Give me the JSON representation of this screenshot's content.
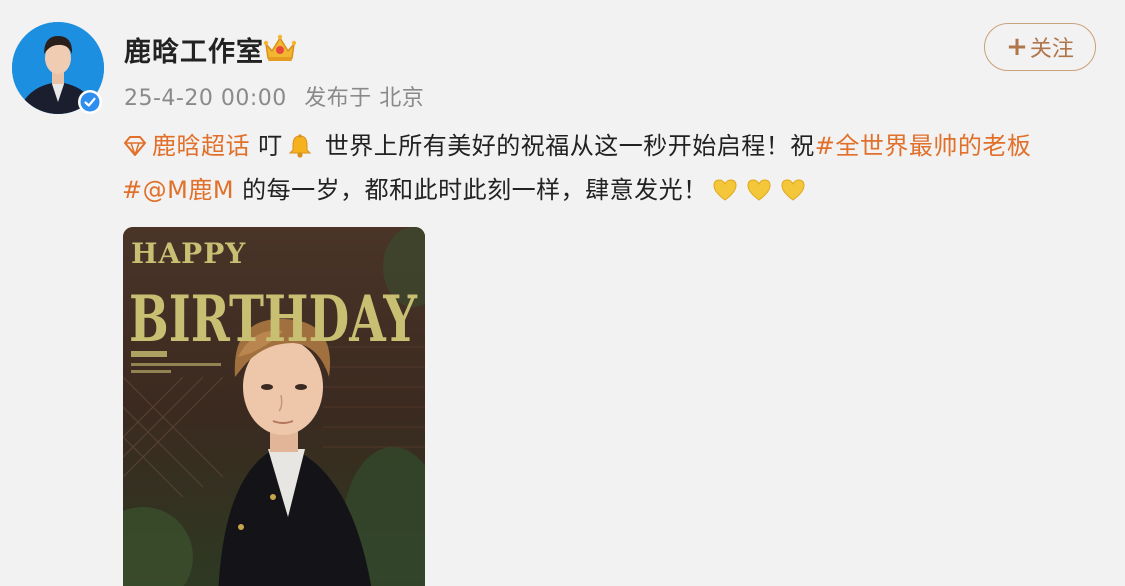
{
  "user": {
    "name": "鹿晗工作室",
    "timestamp": "25-4-20 00:00",
    "location": "发布于 北京"
  },
  "follow": {
    "plus": "+",
    "label": "关注"
  },
  "post": {
    "supertopic": "鹿晗超话",
    "text1": " 叮",
    "text2": " 世界上所有美好的祝福从这一秒开始启程！祝",
    "hashtag": "#全世界最帅的老板#",
    "mention": "@M鹿M",
    "text3": " 的每一岁，都和此时此刻一样，肆意发光！"
  },
  "image": {
    "line1": "HAPPY",
    "line2": "BIRTHDAY"
  },
  "colors": {
    "accent": "#e0702a",
    "follow_border": "#c8a27a",
    "verified": "#2d8ef0"
  }
}
